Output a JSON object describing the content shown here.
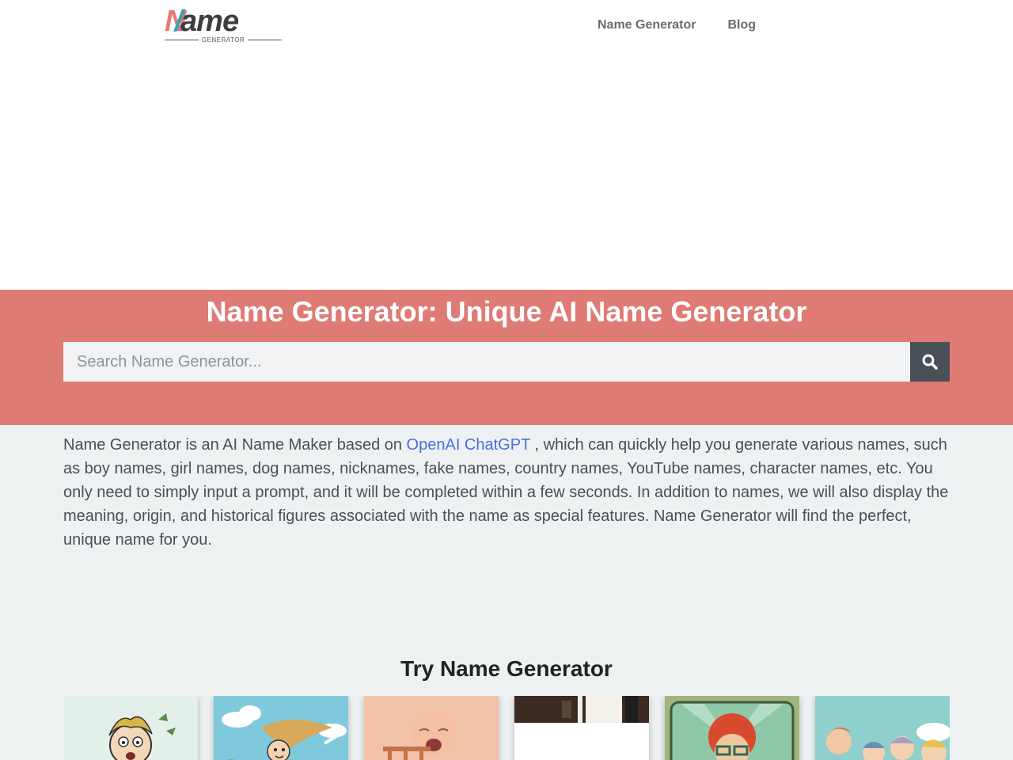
{
  "header": {
    "logo": {
      "text_main": "Name",
      "text_sub": "GENERATOR"
    },
    "nav": [
      {
        "label": "Name Generator"
      },
      {
        "label": "Blog"
      }
    ]
  },
  "hero": {
    "title": "Name Generator: Unique AI Name Generator",
    "search": {
      "placeholder": "Search Name Generator...",
      "value": "",
      "button_icon": "search-icon"
    }
  },
  "intro": {
    "before_link": "Name Generator is an AI Name Maker based on ",
    "link_text": "OpenAI ChatGPT",
    "after_link": " , which can quickly help you generate various names, such as boy names, girl names, dog names, nicknames, fake names, country names, YouTube names, character names, etc. You only need to simply input a prompt, and it will be completed within a few seconds. In addition to names, we will also display the meaning, origin, and historical figures associated with the name as special features. Name Generator will find the perfect, unique name for you."
  },
  "try_section": {
    "title": "Try Name Generator",
    "cards": [
      {
        "image": "cartoon-screaming-boy"
      },
      {
        "image": "cartoon-running-girl"
      },
      {
        "image": "cartoon-crying-baby"
      },
      {
        "image": "room-interior"
      },
      {
        "image": "cartoon-red-haired-man"
      },
      {
        "image": "cartoon-group-of-kids"
      }
    ]
  },
  "colors": {
    "hero_bg": "#de7b74",
    "content_bg": "#eef1f2",
    "link": "#4a6ee0",
    "search_button": "#4a5057"
  }
}
